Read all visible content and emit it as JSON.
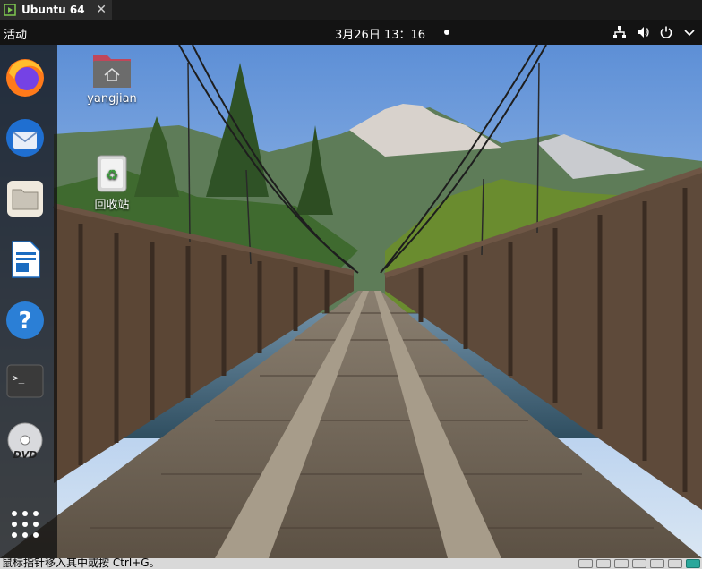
{
  "vm_window": {
    "tab_title": "Ubuntu 64",
    "close_glyph": "✕",
    "status_hint": "鼠标指针移入其中或按 Ctrl+G。",
    "status_icons": [
      "hdd-icon",
      "cdrom-icon",
      "network-icon",
      "usb-icon",
      "sound-icon",
      "printer-icon",
      "display-icon"
    ]
  },
  "topbar": {
    "activities": "活动",
    "clock": "3月26日  13：16",
    "tray_icons": [
      "network-icon",
      "volume-icon",
      "power-icon",
      "chevron-down-icon"
    ]
  },
  "dock": {
    "items": [
      "firefox",
      "thunderbird",
      "files",
      "libreoffice-writer",
      "help",
      "terminal",
      "dvd",
      "show-apps"
    ]
  },
  "desktop": {
    "icons": [
      {
        "label": "yangjian",
        "icon": "home-folder-icon"
      },
      {
        "label": "回收站",
        "icon": "trash-icon"
      }
    ]
  },
  "colors": {
    "accent": "#e95420",
    "dock_bg": "#121212",
    "topbar_bg": "#131313"
  }
}
